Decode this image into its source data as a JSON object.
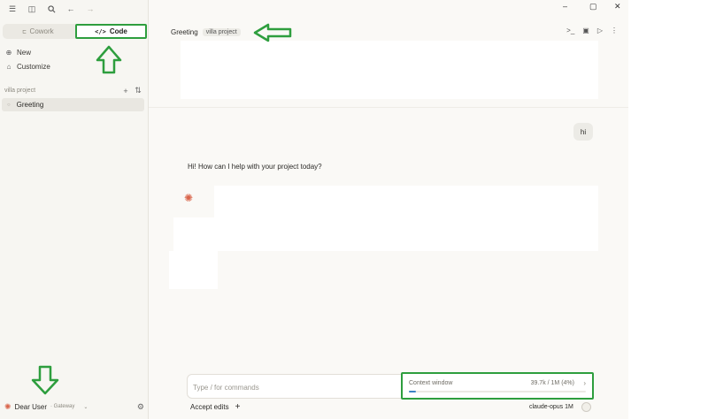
{
  "sidebar": {
    "modes": {
      "cowork": "Cowork",
      "code": "Code"
    },
    "actions": {
      "new": "New",
      "customize": "Customize"
    },
    "project": {
      "name": "villa project"
    },
    "sessions": [
      {
        "label": "Greeting"
      }
    ],
    "user": {
      "name": "Dear User",
      "org": "Gateway"
    }
  },
  "header": {
    "title": "Greeting",
    "project_tag": "villa project"
  },
  "chat": {
    "user_message": "hi",
    "assistant_message": "Hi! How can I help with your project today?"
  },
  "composer": {
    "placeholder": "Type / for commands",
    "accept_edits": "Accept edits",
    "add": "+",
    "model": "claude-opus 1M"
  },
  "context_window": {
    "label": "Context window",
    "value": "39.7k / 1M (4%)",
    "fraction": 0.04
  },
  "colors": {
    "annotation": "#2e9e3e",
    "accent": "#d9654b",
    "progress": "#3b82c4"
  }
}
